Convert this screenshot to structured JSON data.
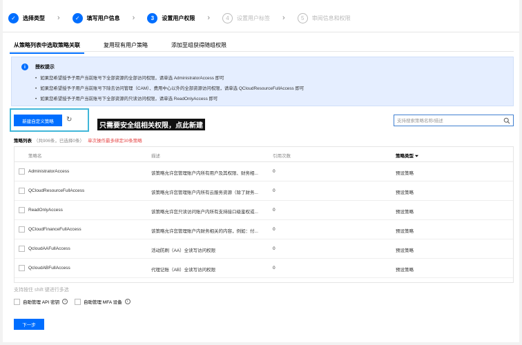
{
  "steps": [
    {
      "num": "✓",
      "label": "选择类型",
      "state": "done"
    },
    {
      "num": "✓",
      "label": "填写用户信息",
      "state": "done"
    },
    {
      "num": "3",
      "label": "设置用户权限",
      "state": "active"
    },
    {
      "num": "4",
      "label": "设置用户标签",
      "state": "todo"
    },
    {
      "num": "5",
      "label": "审阅信息和权限",
      "state": "todo"
    }
  ],
  "tabs": [
    "从策略列表中选取策略关联",
    "复用现有用户策略",
    "添加至组获得随组权限"
  ],
  "info": {
    "title": "授权提示",
    "lines": [
      "如果您希望授予子用户当前账号下全部资源的全部访问权限，请单选 AdministratorAccess 即可",
      "如果您希望授予子用户当前账号下除去访问管理（CAM）、费用中心以外的全部资源访问权限，请单选 QCloudResourceFullAccess 即可",
      "如果您希望授予子用户当前账号下全部资源的只读访问权限，请单选 ReadOnlyAccess 即可"
    ]
  },
  "toolbar": {
    "create_label": "新建自定义策略",
    "annotation": "只需要安全组相关权限，点此新建",
    "search_placeholder": "支持搜索策略名称/描述"
  },
  "list": {
    "title": "策略列表",
    "count": "（共906条，已选择0条）",
    "warning": "单次操作最多绑定30条策略"
  },
  "table": {
    "headers": {
      "name": "策略名",
      "desc": "描述",
      "refs": "引用次数",
      "type": "策略类型"
    },
    "rows": [
      {
        "name": "AdministratorAccess",
        "desc": "该策略允许您管理账户内所有用户及其权限、财务相...",
        "refs": "0",
        "type": "预设策略"
      },
      {
        "name": "QCloudResourceFullAccess",
        "desc": "该策略允许您管理账户内所有云服务资源（除了财务...",
        "refs": "0",
        "type": "预设策略"
      },
      {
        "name": "ReadOnlyAccess",
        "desc": "该策略允许您只读访问账户内所有支持接口级鉴权或...",
        "refs": "0",
        "type": "预设策略"
      },
      {
        "name": "QCloudFinanceFullAccess",
        "desc": "该策略允许您管理账户内财务相关的内容，例如：付...",
        "refs": "0",
        "type": "预设策略"
      },
      {
        "name": "QcloudAAFullAccess",
        "desc": "活动防刷（AA）全读写访问权限",
        "refs": "0",
        "type": "预设策略"
      },
      {
        "name": "QcloudABFullAccess",
        "desc": "代理记账（AB）全读写访问权限",
        "refs": "0",
        "type": "预设策略"
      }
    ]
  },
  "hint": "支持按住 shift 键进行多选",
  "options": [
    "自助管理 API 密钥",
    "自助管理 MFA 设备"
  ],
  "next_label": "下一步",
  "colors": {
    "accent": "#006eff",
    "warning": "#e54545",
    "info_bg": "#e5eeff",
    "highlight": "#3fb6d9"
  }
}
